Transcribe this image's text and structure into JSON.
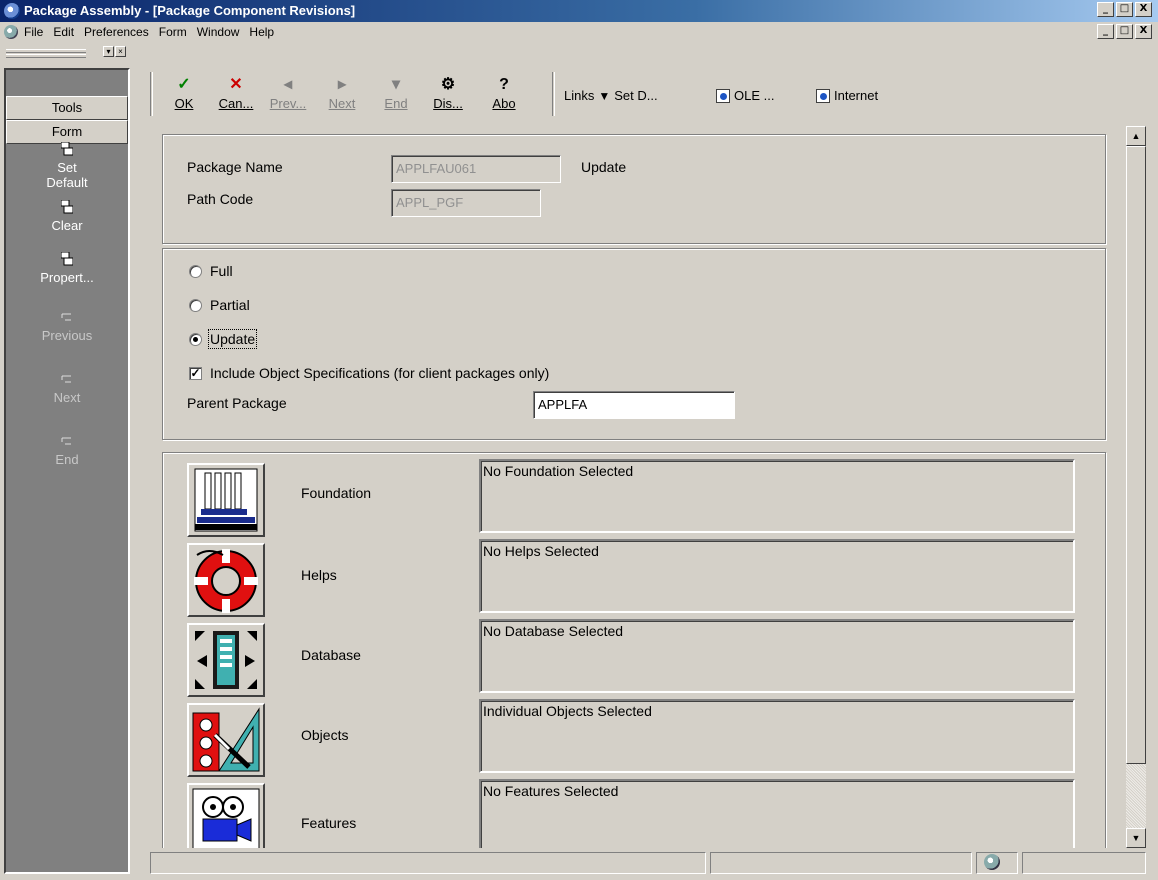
{
  "window": {
    "title": "Package Assembly - [Package Component Revisions]",
    "controls": [
      "_",
      "□",
      "X"
    ]
  },
  "menu": {
    "items": [
      "File",
      "Edit",
      "Preferences",
      "Form",
      "Window",
      "Help"
    ]
  },
  "exit_bar": {
    "tabs": [
      "Tools",
      "Form"
    ],
    "items": [
      {
        "label": "Set\nDefault",
        "enabled": true,
        "icon": "form-exit-icon"
      },
      {
        "label": "Clear",
        "enabled": true,
        "icon": "form-exit-icon"
      },
      {
        "label": "Propert...",
        "enabled": true,
        "icon": "form-exit-icon"
      },
      {
        "label": "Previous",
        "enabled": false,
        "icon": "form-exit-icon"
      },
      {
        "label": "Next",
        "enabled": false,
        "icon": "form-exit-icon"
      },
      {
        "label": "End",
        "enabled": false,
        "icon": "form-exit-icon"
      }
    ]
  },
  "toolbar": {
    "buttons": [
      {
        "label": "OK",
        "icon": "check-icon",
        "enabled": true,
        "color": "#008000"
      },
      {
        "label": "Can...",
        "icon": "cancel-x-icon",
        "enabled": true,
        "color": "#cc0000"
      },
      {
        "label": "Prev...",
        "icon": "previous-icon",
        "enabled": false
      },
      {
        "label": "Next",
        "icon": "next-icon",
        "enabled": false
      },
      {
        "label": "End",
        "icon": "end-icon",
        "enabled": false
      },
      {
        "label": "Dis...",
        "icon": "display-icon",
        "enabled": true
      },
      {
        "label": "Abo",
        "icon": "about-help-icon",
        "enabled": true
      }
    ],
    "links_label": "Links",
    "set_default_label": "Set D...",
    "ole_label": "OLE ...",
    "internet_label": "Internet"
  },
  "header": {
    "package_name_label": "Package Name",
    "package_name_value": "APPLFAU061",
    "package_type_text": "Update",
    "path_code_label": "Path Code",
    "path_code_value": "APPL_PGF"
  },
  "options": {
    "radios": [
      {
        "label": "Full",
        "selected": false
      },
      {
        "label": "Partial",
        "selected": false
      },
      {
        "label": "Update",
        "selected": true
      }
    ],
    "include_specs_label": "Include Object Specifications (for client packages only)",
    "include_specs_checked": true,
    "parent_package_label": "Parent Package",
    "parent_package_value": "APPLFA"
  },
  "components": [
    {
      "label": "Foundation",
      "status": "No Foundation Selected",
      "icon": "foundation-column-icon"
    },
    {
      "label": "Helps",
      "status": "No Helps Selected",
      "icon": "life-ring-icon"
    },
    {
      "label": "Database",
      "status": "No Database Selected",
      "icon": "database-icon"
    },
    {
      "label": "Objects",
      "status": "Individual Objects Selected",
      "icon": "objects-tools-icon"
    },
    {
      "label": "Features",
      "status": "No Features Selected",
      "icon": "features-camera-icon"
    }
  ]
}
